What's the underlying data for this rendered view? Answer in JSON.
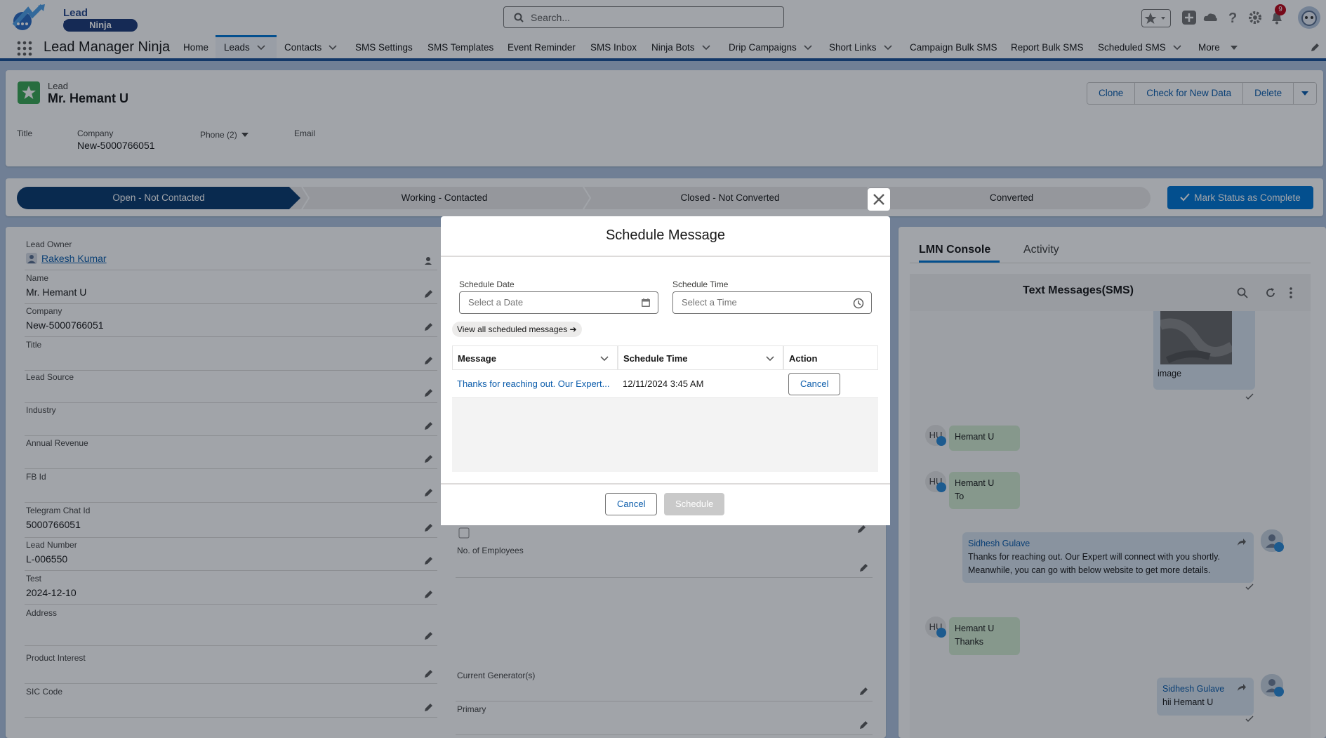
{
  "app": {
    "logo_line1": "Lead Manager",
    "logo_line2": "Ninja",
    "name": "Lead Manager Ninja",
    "notification_count": "9",
    "search_placeholder": "Search..."
  },
  "nav": {
    "items": [
      {
        "label": "Home",
        "dropdown": false
      },
      {
        "label": "Leads",
        "dropdown": true,
        "active": true
      },
      {
        "label": "Contacts",
        "dropdown": true
      },
      {
        "label": "SMS Settings",
        "dropdown": false
      },
      {
        "label": "SMS Templates",
        "dropdown": false
      },
      {
        "label": "Event Reminder",
        "dropdown": false
      },
      {
        "label": "SMS Inbox",
        "dropdown": false
      },
      {
        "label": "Ninja Bots",
        "dropdown": true
      },
      {
        "label": "Drip Campaigns",
        "dropdown": true
      },
      {
        "label": "Short Links",
        "dropdown": true
      },
      {
        "label": "Campaign Bulk SMS",
        "dropdown": false
      },
      {
        "label": "Report Bulk SMS",
        "dropdown": false
      },
      {
        "label": "Scheduled SMS",
        "dropdown": true
      },
      {
        "label": "More",
        "dropdown": true
      }
    ]
  },
  "record": {
    "type": "Lead",
    "name": "Mr. Hemant U",
    "actions": [
      "Clone",
      "Check for New Data",
      "Delete"
    ],
    "highlights": {
      "title_label": "Title",
      "company_label": "Company",
      "company_value": "New-5000766051",
      "phone_label": "Phone (2)",
      "email_label": "Email"
    }
  },
  "path": {
    "stages": [
      "Open - Not Contacted",
      "Working - Contacted",
      "Closed - Not Converted",
      "Converted"
    ],
    "current": 0,
    "mark_button": "Mark Status as Complete"
  },
  "details": {
    "lead_owner_label": "Lead Owner",
    "lead_owner": "Rakesh Kumar",
    "fields_left": [
      {
        "label": "Name",
        "value": "Mr. Hemant U"
      },
      {
        "label": "Company",
        "value": "New-5000766051"
      },
      {
        "label": "Title",
        "value": ""
      },
      {
        "label": "Lead Source",
        "value": ""
      },
      {
        "label": "Industry",
        "value": ""
      },
      {
        "label": "Annual Revenue",
        "value": ""
      },
      {
        "label": "FB Id",
        "value": ""
      },
      {
        "label": "Telegram Chat Id",
        "value": "5000766051"
      },
      {
        "label": "Lead Number",
        "value": "L-006550"
      },
      {
        "label": "Test",
        "value": "2024-12-10"
      },
      {
        "label": "Address",
        "value": ""
      },
      {
        "label": "Product Interest",
        "value": ""
      },
      {
        "label": "SIC Code",
        "value": ""
      }
    ],
    "right_fields": {
      "employees_label": "No. of Employees",
      "generators_label": "Current Generator(s)",
      "primary_label": "Primary"
    }
  },
  "console": {
    "tabs": [
      "LMN Console",
      "Activity"
    ],
    "sms_title": "Text Messages(SMS)",
    "messages": [
      {
        "sender": "",
        "initials": "",
        "text": "image",
        "direction": "in"
      },
      {
        "sender": "Hemant U",
        "initials": "HU",
        "text": "",
        "direction": "in"
      },
      {
        "sender": "Hemant U",
        "initials": "HU",
        "text": "To",
        "direction": "in"
      },
      {
        "sender": "Sidhesh Gulave",
        "initials": "",
        "text": "Thanks for reaching out. Our Expert will connect with you shortly. Meanwhile, you can go with below website to get more details.",
        "direction": "out"
      },
      {
        "sender": "Hemant U",
        "initials": "HU",
        "text": "Thanks",
        "direction": "in"
      },
      {
        "sender": "Sidhesh Gulave",
        "initials": "",
        "text": "hii Hemant U",
        "direction": "out"
      }
    ]
  },
  "modal": {
    "title": "Schedule Message",
    "date_label": "Schedule Date",
    "date_placeholder": "Select a Date",
    "time_label": "Schedule Time",
    "time_placeholder": "Select a Time",
    "view_all": "View all scheduled messages ➔",
    "columns": [
      "Message",
      "Schedule Time",
      "Action"
    ],
    "rows": [
      {
        "message": "Thanks for reaching out. Our Expert...",
        "time": "12/11/2024 3:45 AM",
        "action": "Cancel"
      }
    ],
    "cancel": "Cancel",
    "schedule": "Schedule"
  },
  "colors": {
    "brand": "#0176d3",
    "nav_underline": "#1b5297",
    "path_current": "#0b3a6e",
    "lead_icon": "#3ba755",
    "incoming_bubble": "#d3ecd1",
    "outgoing_bubble": "#d9e4ef"
  }
}
